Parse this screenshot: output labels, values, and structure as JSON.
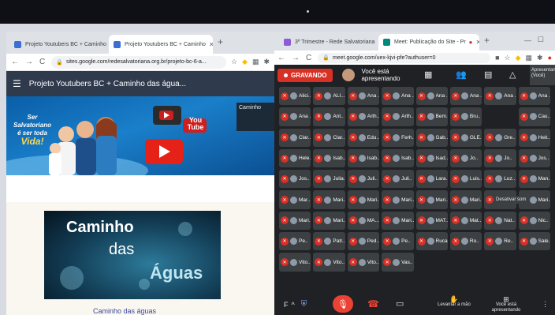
{
  "left_browser": {
    "tabs": [
      {
        "label": "Projeto Youtubers BC + Caminho"
      },
      {
        "label": "Projeto Youtubers BC + Caminho"
      }
    ],
    "url": "sites.google.com/redesalvatoriana.org.br/projeto-bc-6-a...",
    "site_title": "Projeto Youtubers BC + Caminho das água...",
    "banner": {
      "slogan_line1": "Ser",
      "slogan_line2": "Salvatoriano",
      "slogan_line3": "é ser toda",
      "slogan_line4": "Vida!",
      "youtube_label": "You Tube",
      "thumb_label": "Caminho"
    },
    "video": {
      "line1": "Caminho",
      "line2": "das",
      "line3": "Águas"
    },
    "caption": "Caminho das águas"
  },
  "right_browser": {
    "tabs": [
      {
        "label": "3º Trimestre - Rede Salvatoriana"
      },
      {
        "label": "Meet: Publicação do Site - Pr"
      }
    ],
    "url": "meet.google.com/uex-kjvi-pfe?authuser=0",
    "recording_label": "GRAVANDO",
    "presenting_label": "Você está apresentando",
    "side_label": "Apresentan (Você)",
    "tooltip": "Desativar som",
    "participants": [
      "Alici..",
      "ALI...",
      "Ana ..",
      "Ana ..",
      "Ana ..",
      "Ana ..",
      "Ana ..",
      "Ana ..",
      "Ana ..",
      "Ant..",
      "Arth..",
      "Arth..",
      "Bem..",
      "Bru..",
      "",
      "Cau..",
      "Clar..",
      "Clar..",
      "Edu..",
      "Ferh..",
      "Gab..",
      "GLE..",
      "Gre..",
      "Heit..",
      "Hele..",
      "Isab..",
      "Isab..",
      "Isab..",
      "Isad..",
      "Jo..",
      "Jo..",
      "Jos..",
      "Jos..",
      "Julia..",
      "Juli..",
      "Juli..",
      "Lara..",
      "Luis..",
      "Luz..",
      "Man..",
      "Mar..",
      "Mari..",
      "Mari..",
      "Mari..",
      "Mari..",
      "Mari..",
      "Mari..",
      "Mari..",
      "Mari..",
      "Mari..",
      "MA...",
      "Mari..",
      "MAT...",
      "Mat..",
      "Nat..",
      "Nic..",
      "Pe..",
      "Patr..",
      "Ped..",
      "Pe..",
      "Ruca..",
      "Ro..",
      "Re..",
      "Sale..",
      "Vito..",
      "Vito..",
      "Vito..",
      "Vas..",
      "",
      "",
      "",
      "",
      "",
      "",
      "",
      "",
      "",
      "",
      "",
      ""
    ],
    "toolbar": {
      "meeting_initial": "F",
      "raise_hand": "Levantar a mão",
      "presenting": "Você está apresentando"
    }
  }
}
